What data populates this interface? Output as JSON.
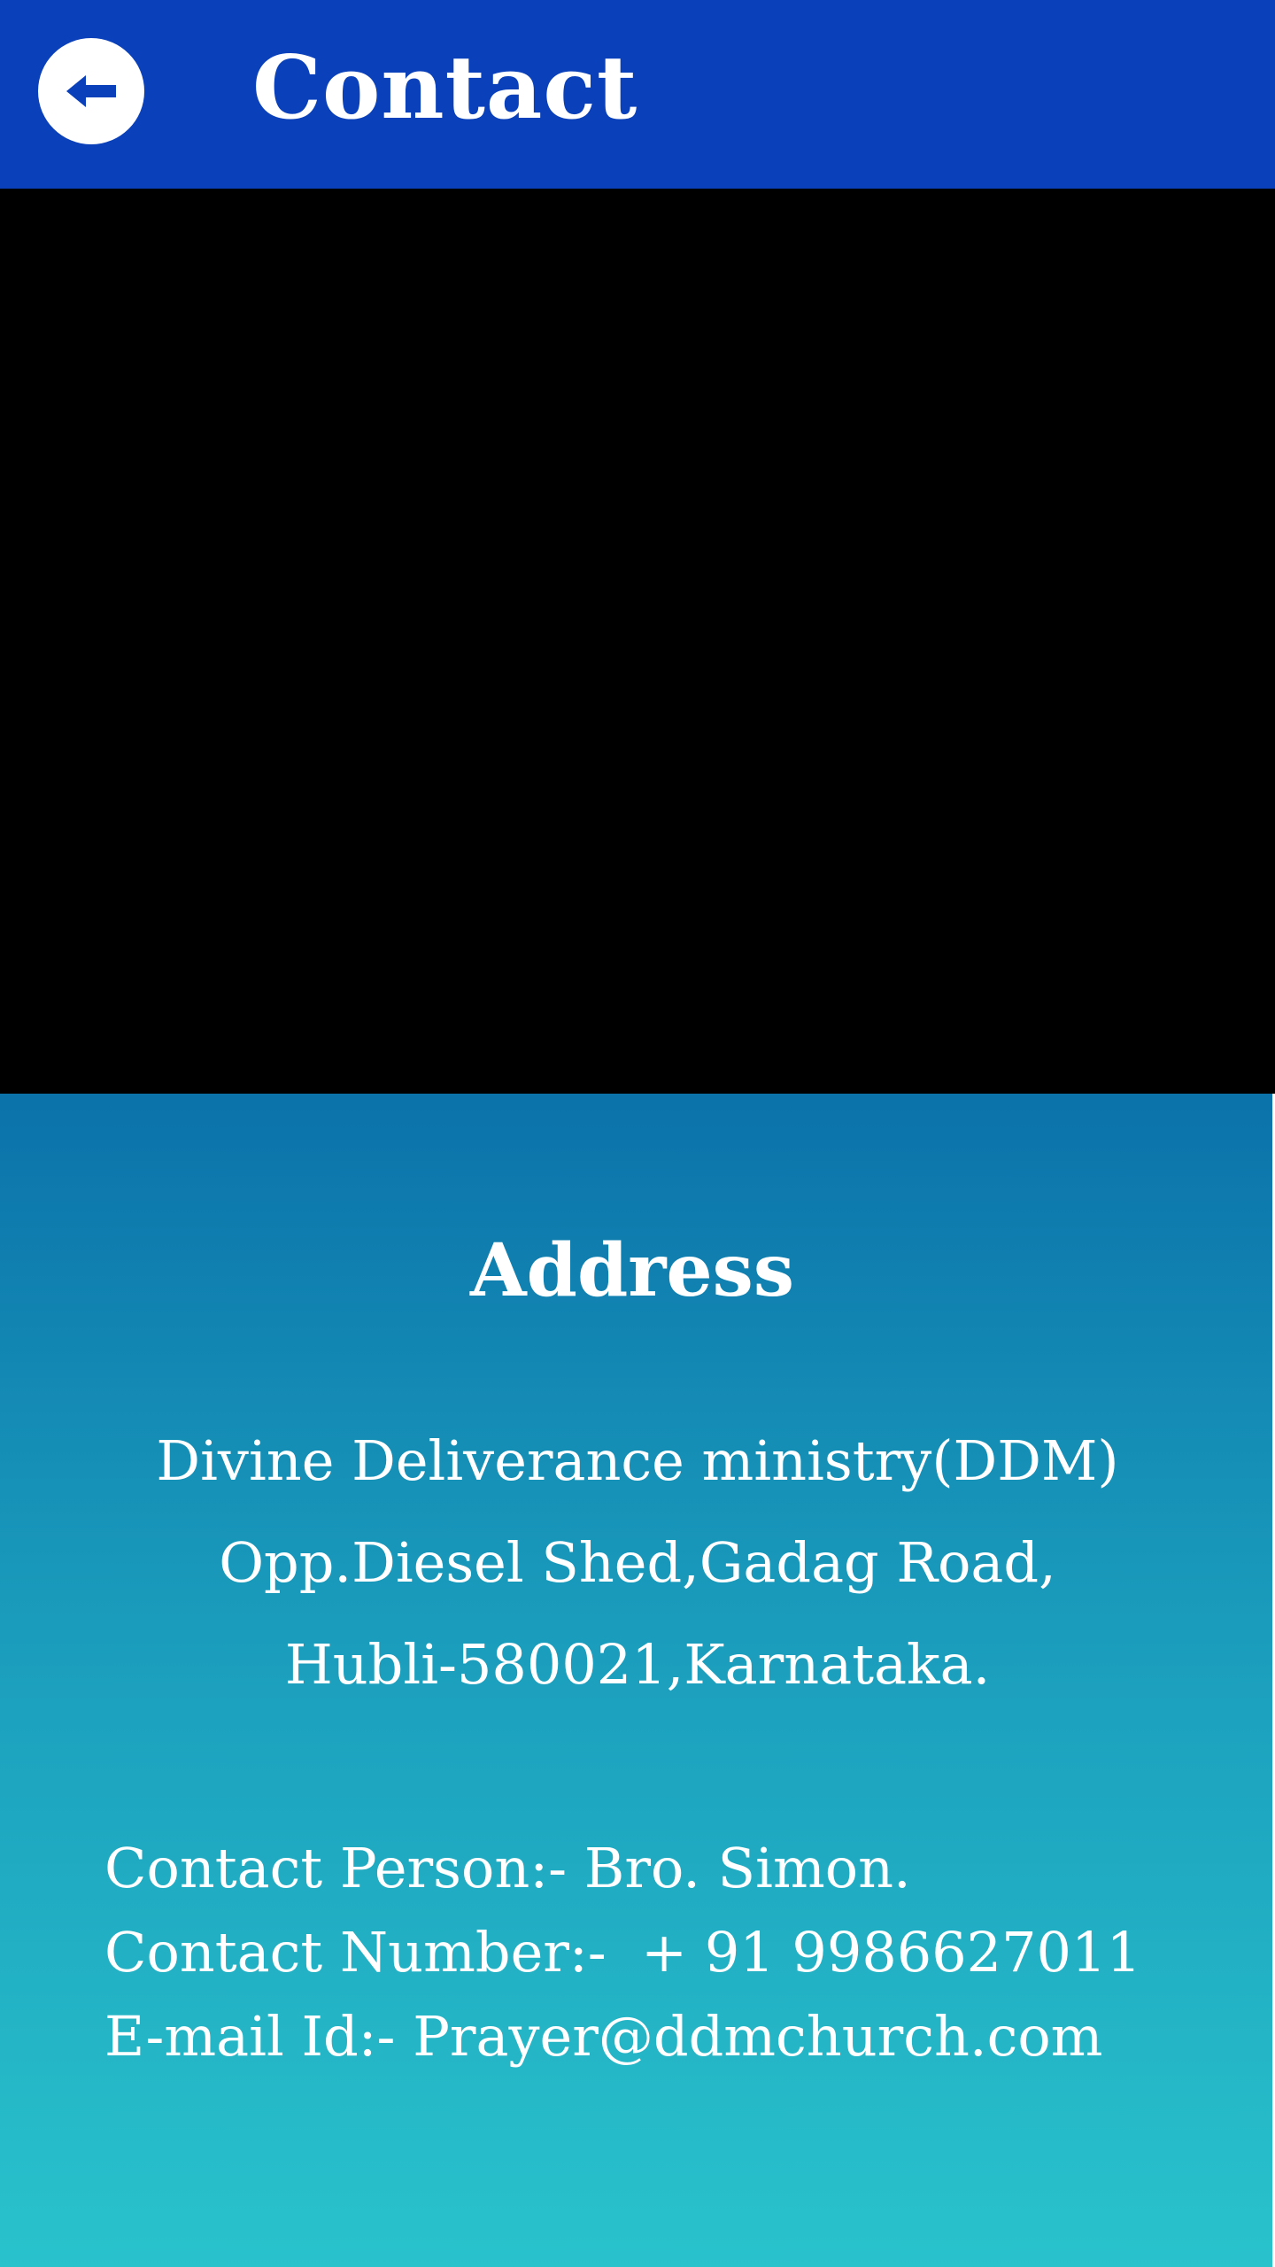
{
  "header": {
    "title": "Contact",
    "back_icon": "arrow-left-icon",
    "background_color": "#0a40ba",
    "icon_color": "#0a40ba"
  },
  "address": {
    "heading": "Address",
    "lines": [
      "Divine Deliverance ministry(DDM)",
      "Opp.Diesel Shed,Gadag Road,",
      "Hubli-580021,Karnataka."
    ]
  },
  "contact": {
    "person": "Contact Person:- Bro. Simon.",
    "number": "Contact Number:-  + 91 9986627011",
    "email": "E-mail Id:- Prayer@ddmchurch.com"
  },
  "colors": {
    "gradient_top": "#0b72aa",
    "gradient_bottom": "#29c3cc",
    "media_background": "#000000"
  }
}
